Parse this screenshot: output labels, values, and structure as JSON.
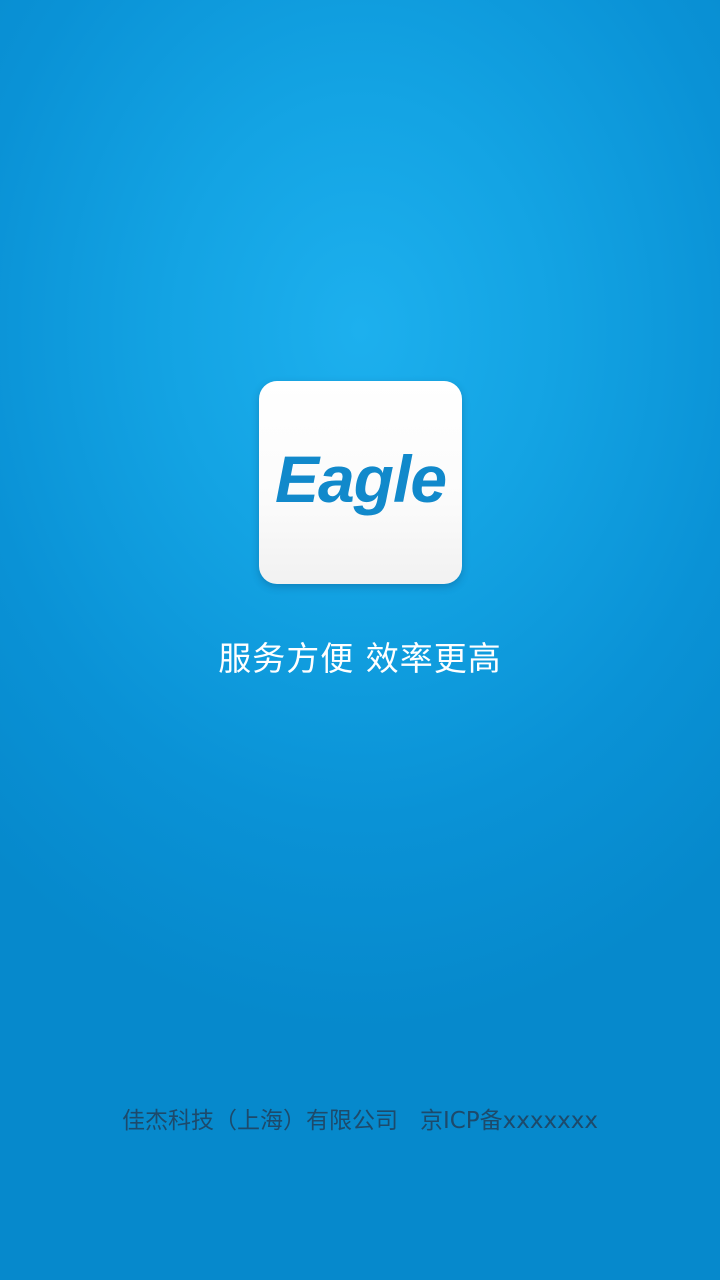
{
  "splash": {
    "background_color": "#13a3e3",
    "logo": {
      "text": "Eagle",
      "color": "#1189cb"
    },
    "tagline": "服务方便 效率更高",
    "footer": "佳杰科技（上海）有限公司   京ICP备xxxxxxx"
  }
}
